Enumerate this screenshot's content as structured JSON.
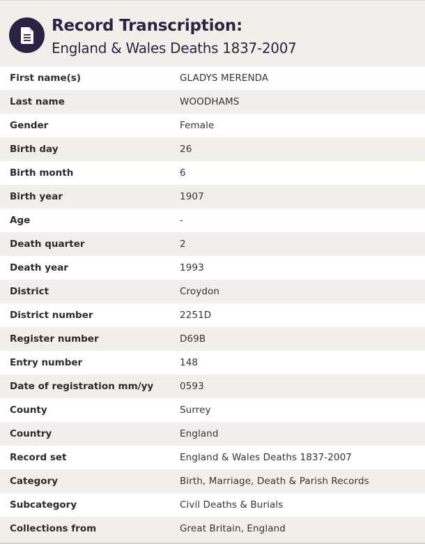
{
  "header": {
    "icon": "document-icon",
    "title": "Record Transcription:",
    "subtitle": "England & Wales Deaths 1837-2007"
  },
  "colors": {
    "accent": "#2a2343",
    "row_alt": "#f2efeb",
    "row_base": "#ffffff"
  },
  "record": [
    {
      "label": "First name(s)",
      "value": "GLADYS MERENDA"
    },
    {
      "label": "Last name",
      "value": "WOODHAMS"
    },
    {
      "label": "Gender",
      "value": "Female"
    },
    {
      "label": "Birth day",
      "value": "26"
    },
    {
      "label": "Birth month",
      "value": "6"
    },
    {
      "label": "Birth year",
      "value": "1907"
    },
    {
      "label": "Age",
      "value": "-"
    },
    {
      "label": "Death quarter",
      "value": "2"
    },
    {
      "label": "Death year",
      "value": "1993"
    },
    {
      "label": "District",
      "value": "Croydon"
    },
    {
      "label": "District number",
      "value": "2251D"
    },
    {
      "label": "Register number",
      "value": "D69B"
    },
    {
      "label": "Entry number",
      "value": "148"
    },
    {
      "label": "Date of registration mm/yy",
      "value": "0593"
    },
    {
      "label": "County",
      "value": "Surrey"
    },
    {
      "label": "Country",
      "value": "England"
    },
    {
      "label": "Record set",
      "value": "England & Wales Deaths 1837-2007"
    },
    {
      "label": "Category",
      "value": "Birth, Marriage, Death & Parish Records"
    },
    {
      "label": "Subcategory",
      "value": "Civil Deaths & Burials"
    },
    {
      "label": "Collections from",
      "value": "Great Britain, England"
    }
  ]
}
